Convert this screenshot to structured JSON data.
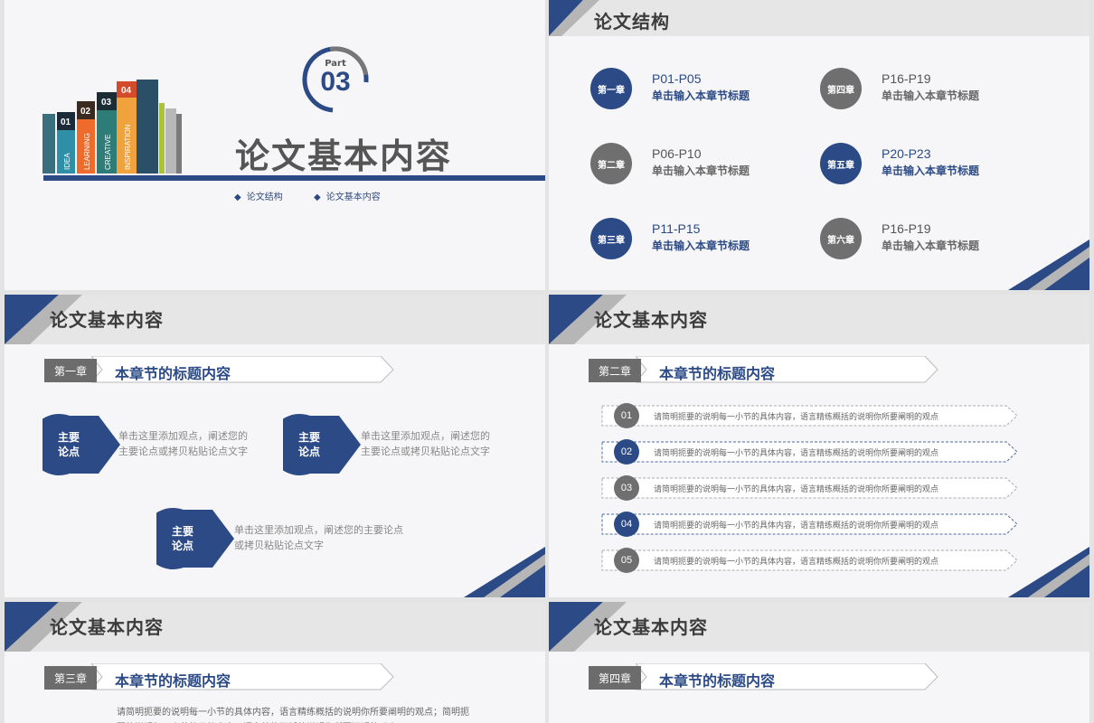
{
  "slide1": {
    "part_label": "Part",
    "part_number": "03",
    "title": "论文基本内容",
    "links": [
      "论文结构",
      "论文基本内容"
    ],
    "books": [
      "01",
      "02",
      "03",
      "04"
    ],
    "book_words": [
      "IDEA",
      "LEARNING",
      "CREATIVE",
      "INSPIRATION"
    ]
  },
  "slide2": {
    "title": "论文结构",
    "chapters": [
      {
        "label": "第一章",
        "pages": "P01-P05",
        "sub": "单击输入本章节标题"
      },
      {
        "label": "第二章",
        "pages": "P06-P10",
        "sub": "单击输入本章节标题"
      },
      {
        "label": "第三章",
        "pages": "P11-P15",
        "sub": "单击输入本章节标题"
      },
      {
        "label": "第四章",
        "pages": "P16-P19",
        "sub": "单击输入本章节标题"
      },
      {
        "label": "第五章",
        "pages": "P20-P23",
        "sub": "单击输入本章节标题"
      },
      {
        "label": "第六章",
        "pages": "P16-P19",
        "sub": "单击输入本章节标题"
      }
    ]
  },
  "slide3": {
    "title": "论文基本内容",
    "chapter_label": "第一章",
    "heading": "本章节的标题内容",
    "points": [
      {
        "label_line1": "主要",
        "label_line2": "论点",
        "desc_line1": "单击这里添加观点，阐述您的",
        "desc_line2": "主要论点或拷贝粘贴论点文字"
      },
      {
        "label_line1": "主要",
        "label_line2": "论点",
        "desc_line1": "单击这里添加观点，阐述您的",
        "desc_line2": "主要论点或拷贝粘贴论点文字"
      },
      {
        "label_line1": "主要",
        "label_line2": "论点",
        "desc_line1": "单击这里添加观点，阐述您的主要论点",
        "desc_line2": "或拷贝粘贴论点文字"
      }
    ]
  },
  "slide4": {
    "title": "论文基本内容",
    "chapter_label": "第二章",
    "heading": "本章节的标题内容",
    "items": [
      {
        "num": "01",
        "text": "请简明扼要的说明每一小节的具体内容，语言精练概括的说明你所要阐明的观点"
      },
      {
        "num": "02",
        "text": "请简明扼要的说明每一小节的具体内容，语言精练概括的说明你所要阐明的观点"
      },
      {
        "num": "03",
        "text": "请简明扼要的说明每一小节的具体内容，语言精练概括的说明你所要阐明的观点"
      },
      {
        "num": "04",
        "text": "请简明扼要的说明每一小节的具体内容，语言精练概括的说明你所要阐明的观点"
      },
      {
        "num": "05",
        "text": "请简明扼要的说明每一小节的具体内容，语言精练概括的说明你所要阐明的观点"
      }
    ]
  },
  "slide5": {
    "title": "论文基本内容",
    "chapter_label": "第三章",
    "heading": "本章节的标题内容",
    "paragraph": "请简明扼要的说明每一小节的具体内容，语言精练概括的说明你所要阐明的观点；简明扼要的说明每一小节的具体内容，语言精练概括的说明你所要阐明的观点"
  },
  "slide6": {
    "title": "论文基本内容",
    "chapter_label": "第四章",
    "heading": "本章节的标题内容"
  },
  "colors": {
    "navy": "#2b4a86",
    "grey": "#6f6f6f",
    "silver": "#b6b6b6"
  }
}
